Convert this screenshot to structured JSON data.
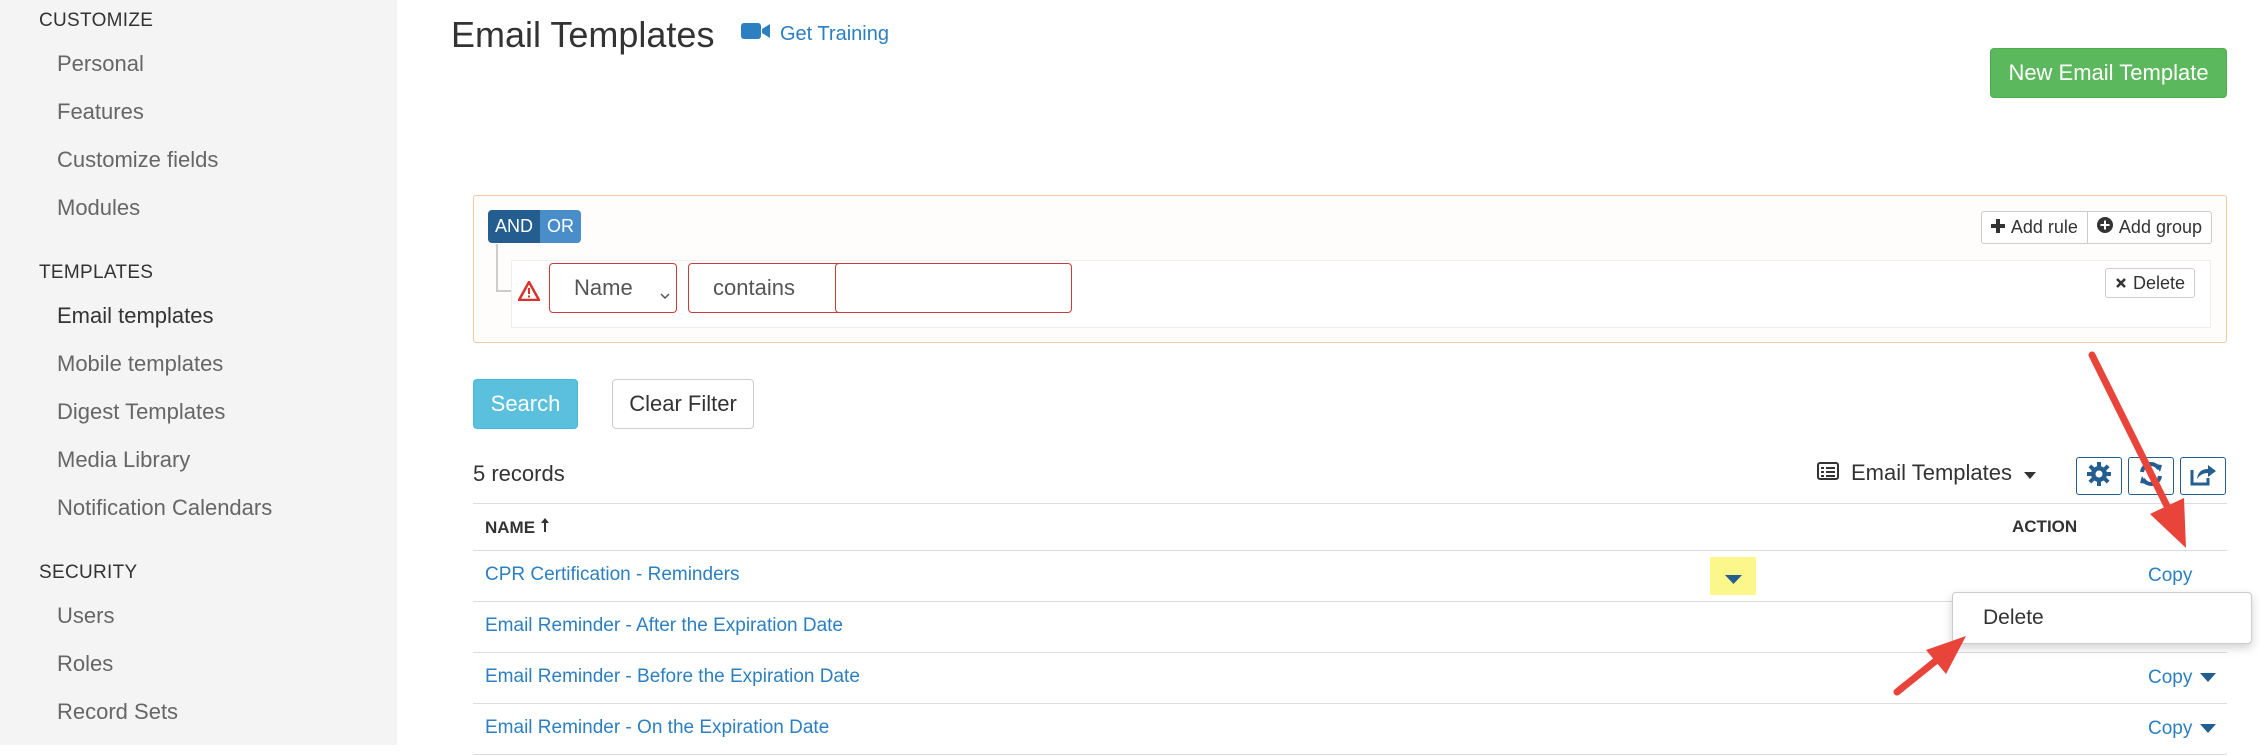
{
  "sidebar": {
    "sections": [
      {
        "title": "CUSTOMIZE",
        "items": [
          "Personal",
          "Features",
          "Customize fields",
          "Modules"
        ]
      },
      {
        "title": "TEMPLATES",
        "items": [
          "Email templates",
          "Mobile templates",
          "Digest Templates",
          "Media Library",
          "Notification Calendars"
        ]
      },
      {
        "title": "SECURITY",
        "items": [
          "Users",
          "Roles",
          "Record Sets"
        ]
      }
    ],
    "active_item": "Email templates"
  },
  "header": {
    "title": "Email Templates",
    "training_label": "Get Training",
    "new_button": "New Email Template"
  },
  "filter": {
    "and_label": "AND",
    "or_label": "OR",
    "add_rule": "Add rule",
    "add_group": "Add group",
    "field_value": "Name",
    "operator_value": "contains",
    "text_value": "",
    "delete_label": "Delete",
    "search_button": "Search",
    "clear_button": "Clear Filter"
  },
  "list": {
    "records_label": "5 records",
    "view_name": "Email Templates",
    "columns": {
      "name": "NAME",
      "action": "ACTION"
    },
    "rows": [
      {
        "name": "CPR Certification - Reminders",
        "action": "Copy"
      },
      {
        "name": "Email Reminder - After the Expiration Date",
        "action": "Copy"
      },
      {
        "name": "Email Reminder - Before the Expiration Date",
        "action": "Copy"
      },
      {
        "name": "Email Reminder - On the Expiration Date",
        "action": "Copy"
      }
    ]
  },
  "dropdown_menu": {
    "item": "Delete"
  },
  "colors": {
    "primary_green": "#5cb85c",
    "info_blue": "#5bc0de",
    "link_blue": "#2c7fc1",
    "highlight": "#fbf78a",
    "arrow_red": "#e8443a"
  }
}
